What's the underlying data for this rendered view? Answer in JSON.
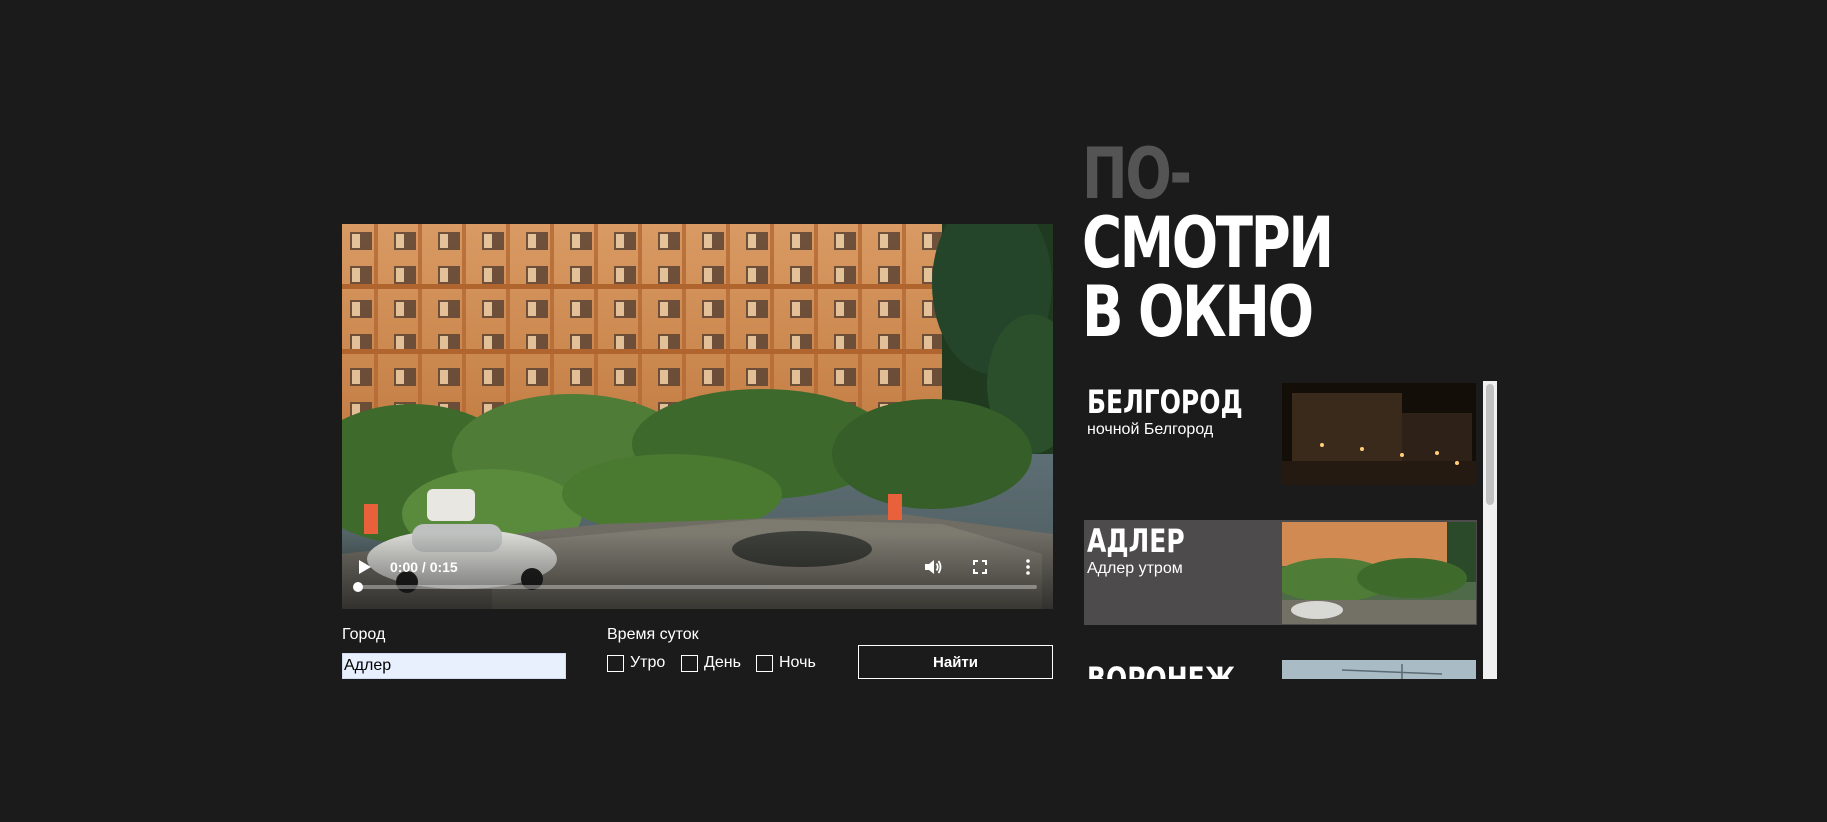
{
  "video": {
    "time": "0:00 / 0:15",
    "progress": 0.0
  },
  "form": {
    "city_label": "Город",
    "city_value": "Адлер",
    "time_label": "Время суток",
    "options": [
      "Утро",
      "День",
      "Ночь"
    ],
    "find_button": "Найти"
  },
  "title": {
    "line1": "ПО-",
    "line2": "СМОТРИ",
    "line3": "В ОКНО"
  },
  "cities": [
    {
      "name": "БЕЛГОРОД",
      "subtitle": "ночной Белгород"
    },
    {
      "name": "АДЛЕР",
      "subtitle": "Адлер утром"
    },
    {
      "name": "ВОРОНЕЖ",
      "subtitle": ""
    }
  ],
  "colors": {
    "background": "#1c1b1c",
    "active_card": "#4e4b4c",
    "title_accent": "#555455",
    "input_bg": "#e8f0fe"
  },
  "icons": [
    "play-icon",
    "volume-icon",
    "fullscreen-icon",
    "more-vert-icon"
  ]
}
